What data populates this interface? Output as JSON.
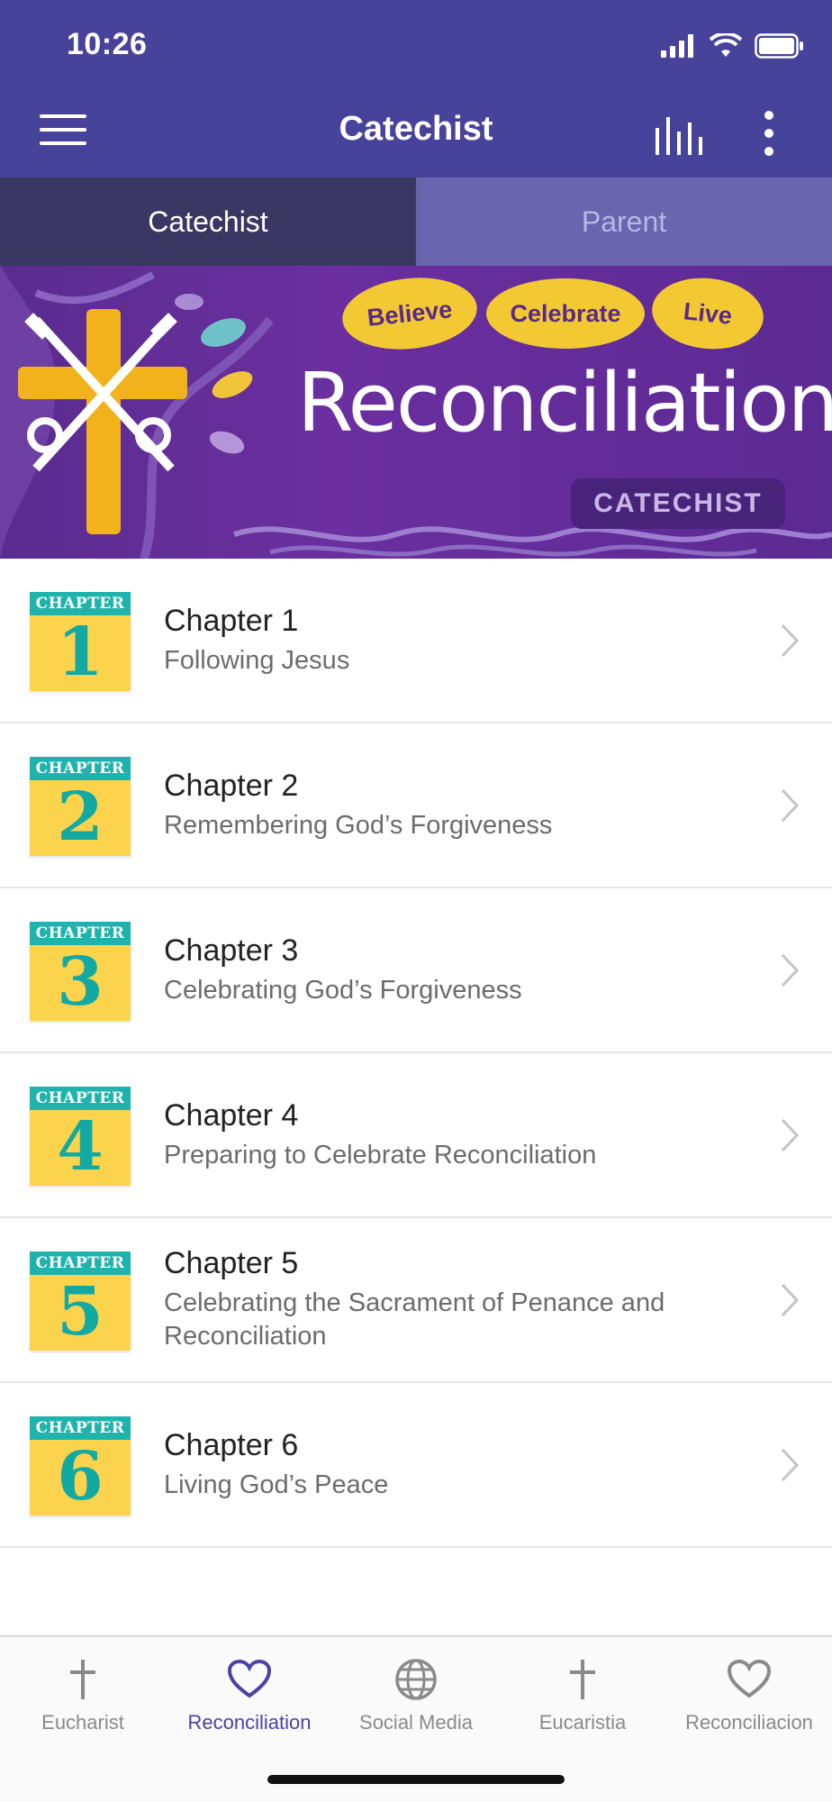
{
  "status_bar": {
    "time": "10:26"
  },
  "header": {
    "title": "Catechist"
  },
  "tabs": [
    {
      "label": "Catechist",
      "active": true
    },
    {
      "label": "Parent",
      "active": false
    }
  ],
  "banner": {
    "leaves": [
      "Believe",
      "Celebrate",
      "Live"
    ],
    "title": "Reconciliation",
    "badge": "CATECHIST"
  },
  "chapters": [
    {
      "badge_label": "CHAPTER",
      "number": "1",
      "title": "Chapter 1",
      "subtitle": "Following Jesus"
    },
    {
      "badge_label": "CHAPTER",
      "number": "2",
      "title": "Chapter 2",
      "subtitle": "Remembering God’s Forgiveness"
    },
    {
      "badge_label": "CHAPTER",
      "number": "3",
      "title": "Chapter 3",
      "subtitle": "Celebrating God’s Forgiveness"
    },
    {
      "badge_label": "CHAPTER",
      "number": "4",
      "title": "Chapter 4",
      "subtitle": "Preparing to Celebrate Reconciliation"
    },
    {
      "badge_label": "CHAPTER",
      "number": "5",
      "title": "Chapter 5",
      "subtitle": "Celebrating the Sacrament of Penance and Reconciliation"
    },
    {
      "badge_label": "CHAPTER",
      "number": "6",
      "title": "Chapter 6",
      "subtitle": "Living God’s Peace"
    }
  ],
  "bottom_nav": [
    {
      "label": "Eucharist",
      "icon": "cross-icon",
      "active": false
    },
    {
      "label": "Reconciliation",
      "icon": "heart-icon",
      "active": true
    },
    {
      "label": "Social Media",
      "icon": "globe-icon",
      "active": false
    },
    {
      "label": "Eucaristia",
      "icon": "cross-icon",
      "active": false
    },
    {
      "label": "Reconciliacion",
      "icon": "heart-icon",
      "active": false
    }
  ],
  "colors": {
    "header_bg": "#48439a",
    "tab_active_bg": "#3a3763",
    "tab_inactive_bg": "#6a65ae",
    "banner_purple": "#5a2c8f",
    "leaf_yellow": "#f3c933",
    "chapter_teal": "#1fb3ad",
    "chapter_yellow": "#fcd34d",
    "nav_active": "#4a43a4"
  }
}
